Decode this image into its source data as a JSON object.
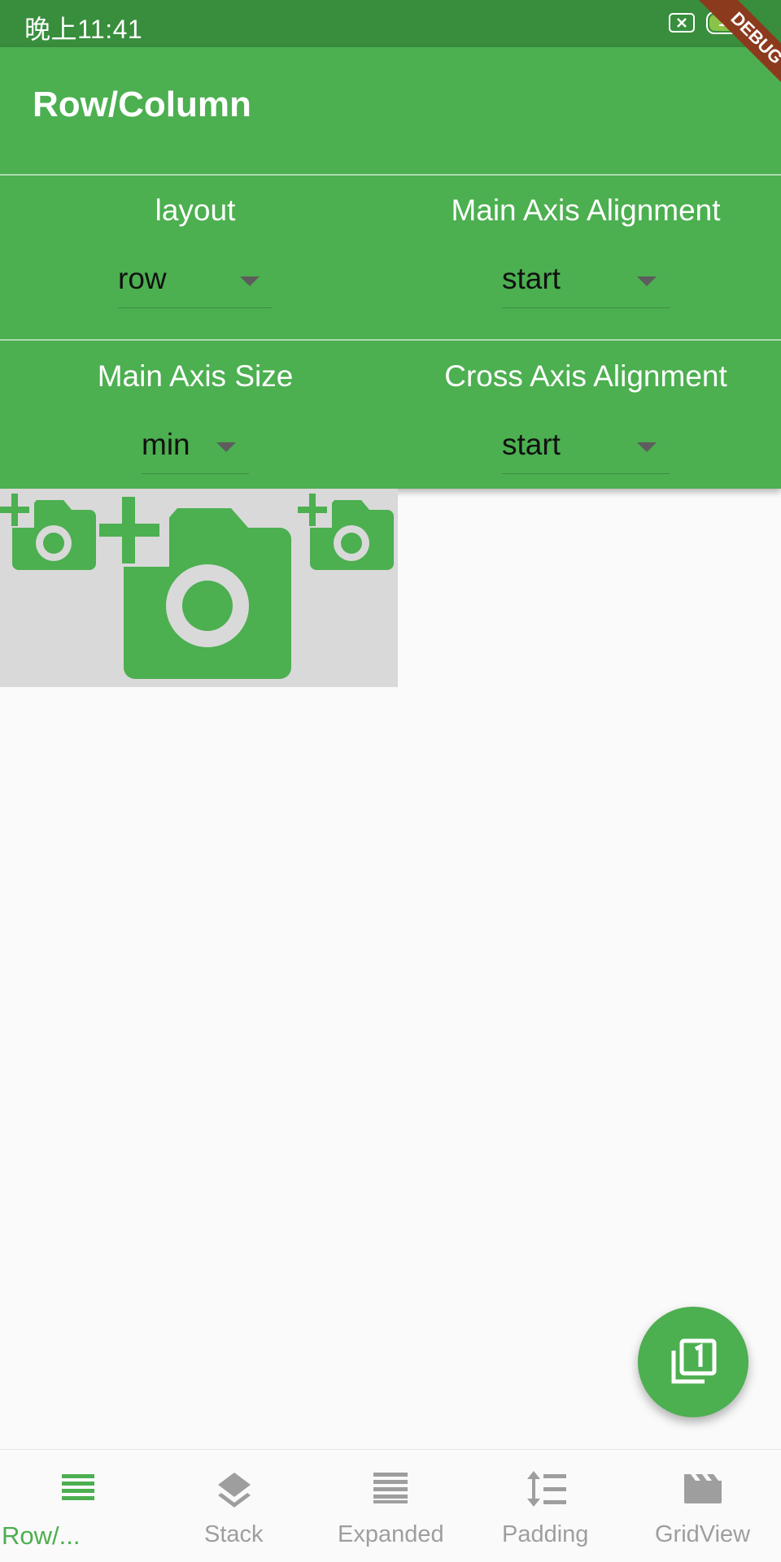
{
  "status_bar": {
    "time": "晚上11:41",
    "battery": "100"
  },
  "app_bar": {
    "title": "Row/Column"
  },
  "controls": {
    "layout": {
      "label": "layout",
      "value": "row"
    },
    "main_axis_alignment": {
      "label": "Main Axis Alignment",
      "value": "start"
    },
    "main_axis_size": {
      "label": "Main Axis Size",
      "value": "min"
    },
    "cross_axis_alignment": {
      "label": "Cross Axis Alignment",
      "value": "start"
    }
  },
  "debug_banner": "DEBUG",
  "bottom_nav": {
    "items": [
      {
        "label": "Row/...",
        "icon": "list-lines-icon",
        "active": true
      },
      {
        "label": "Stack",
        "icon": "layers-icon",
        "active": false
      },
      {
        "label": "Expanded",
        "icon": "expanded-rows-icon",
        "active": false
      },
      {
        "label": "Padding",
        "icon": "line-spacing-icon",
        "active": false
      },
      {
        "label": "GridView",
        "icon": "clapperboard-icon",
        "active": false
      }
    ]
  },
  "colors": {
    "primary": "#4caf50",
    "primary_dark": "#388e3c",
    "inactive": "#9e9e9e",
    "demo_bg": "#d9d9d9"
  },
  "fab": {
    "icon": "filter-1-icon"
  }
}
